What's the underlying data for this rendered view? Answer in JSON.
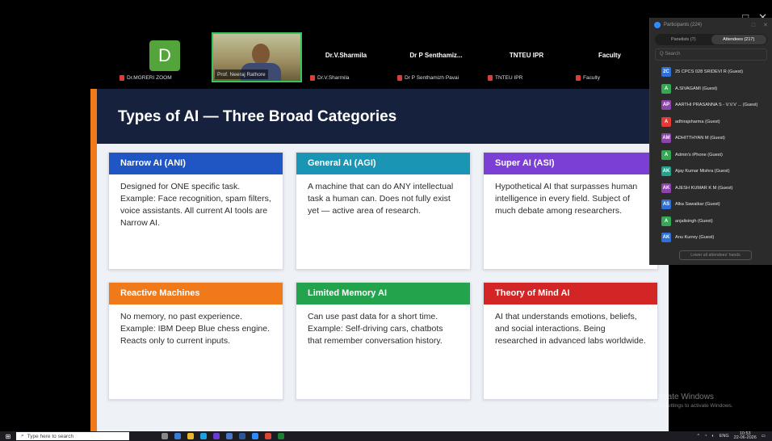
{
  "video_strip": {
    "tiles": [
      {
        "label": "Dr.MGRERI ZOOM",
        "avatar_letter": "D"
      },
      {
        "label": "Prof. Neeraj Rathore"
      },
      {
        "name": "Dr.V.Sharmila",
        "label": "Dr.V.Sharmila"
      },
      {
        "name": "Dr P Senthamiz...",
        "label": "Dr P Senthamizh Pavai"
      },
      {
        "name": "TNTEU IPR",
        "label": "TNTEU IPR"
      },
      {
        "name": "Faculty",
        "label": "Faculty"
      }
    ]
  },
  "slide": {
    "title": "Types of AI — Three Broad Categories",
    "cards": [
      {
        "title": "Narrow AI (ANI)",
        "color": "#1f56c3",
        "text": "Designed for ONE specific task. Example: Face recognition, spam filters, voice assistants. All current AI tools are Narrow AI."
      },
      {
        "title": "General AI (AGI)",
        "color": "#1a96b4",
        "text": "A machine that can do ANY intellectual task a human can. Does not fully exist yet — active area of research."
      },
      {
        "title": "Super AI (ASI)",
        "color": "#7b3fd6",
        "text": "Hypothetical AI that surpasses human intelligence in every field. Subject of much debate among researchers."
      },
      {
        "title": "Reactive Machines",
        "color": "#f07a1a",
        "text": "No memory, no past experience. Example: IBM Deep Blue chess engine. Reacts only to current inputs."
      },
      {
        "title": "Limited Memory AI",
        "color": "#23a34b",
        "text": "Can use past data for a short time. Example: Self-driving cars, chatbots that remember conversation history."
      },
      {
        "title": "Theory of Mind AI",
        "color": "#d32525",
        "text": "AI that understands emotions, beliefs, and social interactions. Being researched in advanced labs worldwide."
      }
    ]
  },
  "participants": {
    "title": "Participants (224)",
    "tabs": [
      "Panelists (7)",
      "Attendees (217)"
    ],
    "search_placeholder": "Q Search",
    "list": [
      {
        "initials": "2C",
        "name": "25  CPCS 028 SRIDEVI R (Guest)",
        "color": "#2f6fd8"
      },
      {
        "initials": "A",
        "name": "A.SIVAGAMI (Guest)",
        "color": "#34a853"
      },
      {
        "initials": "AP",
        "name": "AARTHI PRASANNA S - V.V.V ... (Guest)",
        "color": "#8e44ad"
      },
      {
        "initials": "A",
        "name": "adhirajsharma (Guest)",
        "color": "#e53935"
      },
      {
        "initials": "AM",
        "name": "ADHITTHYAN M (Guest)",
        "color": "#8e44ad"
      },
      {
        "initials": "A",
        "name": "Admin's iPhone (Guest)",
        "color": "#34a853"
      },
      {
        "initials": "AK",
        "name": "Ajay Kumar Mishra (Guest)",
        "color": "#23a38b"
      },
      {
        "initials": "AK",
        "name": "AJESH KUMAR K M (Guest)",
        "color": "#8e44ad"
      },
      {
        "initials": "AS",
        "name": "Alka Sawaikar (Guest)",
        "color": "#2f6fd8"
      },
      {
        "initials": "A",
        "name": "anjalisingh (Guest)",
        "color": "#34a853"
      },
      {
        "initials": "AK",
        "name": "Anu Kurrey (Guest)",
        "color": "#2f6fd8"
      }
    ],
    "lower_hands_label": "Lower all attendees' hands"
  },
  "watermark": {
    "line1": "Activate Windows",
    "line2": "Go to Settings to activate Windows."
  },
  "taskbar": {
    "search_placeholder": "Type here to search",
    "lang": "ENG",
    "time": "10:53",
    "date": "22-06-2026"
  }
}
